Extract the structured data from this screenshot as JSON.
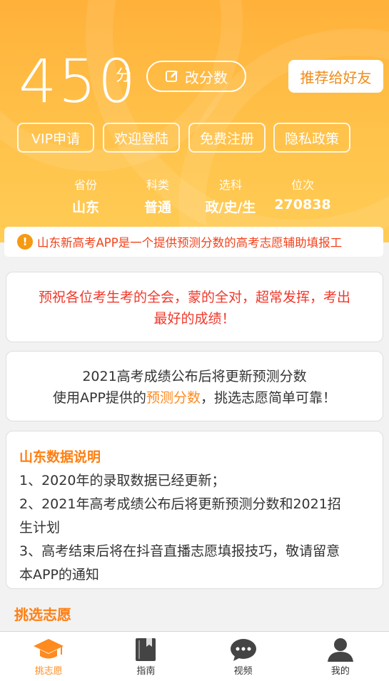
{
  "header": {
    "score": "450",
    "score_unit": "分",
    "edit_label": "改分数",
    "recommend_label": "推荐给好友",
    "pills": [
      "VIP申请",
      "欢迎登陆",
      "免费注册",
      "隐私政策"
    ],
    "stats": [
      {
        "label": "省份",
        "value": "山东"
      },
      {
        "label": "科类",
        "value": "普通"
      },
      {
        "label": "选科",
        "value": "政/史/生"
      },
      {
        "label": "位次",
        "value": "270838"
      }
    ]
  },
  "notice": {
    "icon": "!",
    "text": "山东新高考APP是一个提供预测分数的高考志愿辅助填报工"
  },
  "wish_card": {
    "line1": "预祝各位考生考的全会，蒙的全对，超常发挥，考出",
    "line2": "最好的成绩！"
  },
  "update_card": {
    "line1": "2021高考成绩公布后将更新预测分数",
    "line2_prefix": "使用APP提供的",
    "line2_highlight": "预测分数",
    "line2_suffix": "，挑选志愿简单可靠！"
  },
  "data_card": {
    "title": "山东数据说明",
    "item1": "1、2020年的录取数据已经更新；",
    "item2a": "2、2021年高考成绩公布后将更新预测分数和2021招",
    "item2b": "生计划",
    "item3a": "3、高考结束后将在抖音直播志愿填报技巧，敬请留意",
    "item3b": "本APP的通知"
  },
  "section": {
    "title": "挑选志愿"
  },
  "tabs": [
    {
      "label": "挑志愿",
      "icon": "graduation-cap-icon"
    },
    {
      "label": "指南",
      "icon": "book-icon"
    },
    {
      "label": "视频",
      "icon": "chat-bubble-icon"
    },
    {
      "label": "我的",
      "icon": "user-icon"
    }
  ],
  "colors": {
    "accent": "#ff8a1e",
    "header_top": "#ffb13a",
    "alert_red": "#f2421b"
  }
}
